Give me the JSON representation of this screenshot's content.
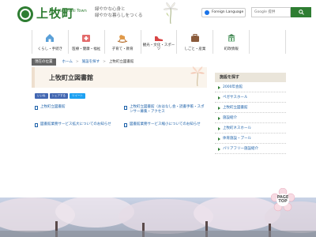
{
  "header": {
    "site_title": "上牧町",
    "site_sub": "Kanmaki Town",
    "tagline_1": "緑やかな心身と",
    "tagline_2": "緑やかな暮らしをつくる",
    "lang_button": "Foreign Language",
    "search_placeholder": "Google 提供"
  },
  "nav": {
    "items": [
      {
        "label": "くらし・手続き",
        "icon": "house-icon"
      },
      {
        "label": "医療・健康・福祉",
        "icon": "medical-icon"
      },
      {
        "label": "子育て・教育",
        "icon": "rocking-horse-icon"
      },
      {
        "label": "観光・文化・スポーツ",
        "icon": "shoe-icon"
      },
      {
        "label": "しごと・産業",
        "icon": "briefcase-icon"
      },
      {
        "label": "町政情報",
        "icon": "building-icon"
      }
    ]
  },
  "breadcrumb": {
    "badge": "現在の位置",
    "items": [
      "ホーム",
      "施設を探す",
      "上牧町立図書館"
    ]
  },
  "page": {
    "title": "上牧町立図書館"
  },
  "social": {
    "buttons": [
      {
        "label": "いいね",
        "color": "#4267b2"
      },
      {
        "label": "シェアする",
        "color": "#4267b2"
      },
      {
        "label": "ツイート",
        "color": "#1da1f2"
      }
    ]
  },
  "links": [
    {
      "label": "上牧町立図書館"
    },
    {
      "label": "上牧町立図書館（おはなし会・読書手帳・スポンサー募集・アクセス"
    },
    {
      "label": "図書館業務サービス拡大についてのお知らせ"
    },
    {
      "label": "図書館業務サービス縮小についてのお知らせ"
    }
  ],
  "sidebar": {
    "heading": "施設を探す",
    "items": [
      "2000年会館",
      "ペガサスホール",
      "上牧町立図書館",
      "施設紹介",
      "上牧町ネスホール",
      "体育施設・プール",
      "バリアフリー施設紹介"
    ]
  },
  "pagetop": {
    "label_1": "PAGE",
    "label_2": "TOP"
  }
}
